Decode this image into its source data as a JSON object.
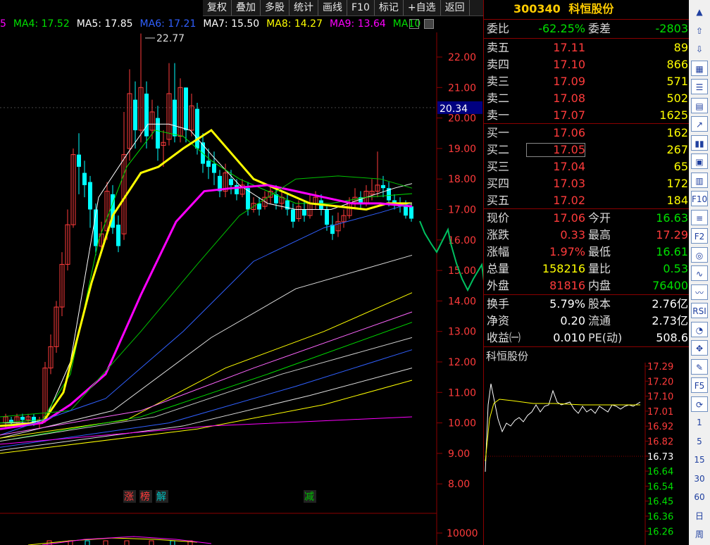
{
  "toolbar": {
    "items": [
      "复权",
      "叠加",
      "多股",
      "统计",
      "画线",
      "F10",
      "标记",
      "+自选",
      "返回"
    ]
  },
  "ma_legend": [
    {
      "label": "5",
      "color": "#ff00ff"
    },
    {
      "label": "MA4: 17.52",
      "color": "#00e000"
    },
    {
      "label": "MA5: 17.85",
      "color": "#ffffff"
    },
    {
      "label": "MA6: 17.21",
      "color": "#3060ff"
    },
    {
      "label": "MA7: 15.50",
      "color": "#ffffff"
    },
    {
      "label": "MA8: 14.27",
      "color": "#ffff00"
    },
    {
      "label": "MA9: 13.64",
      "color": "#ff00ff"
    },
    {
      "label": "MA10",
      "color": "#00e000"
    }
  ],
  "chart": {
    "price_ticks": [
      "22.00",
      "21.00",
      "20.00",
      "19.00",
      "18.00",
      "17.00",
      "16.00",
      "15.00",
      "14.00",
      "13.00",
      "12.00",
      "11.00",
      "10.00",
      "9.00",
      "8.00"
    ],
    "high_label": "22.77",
    "cursor_price": "20.34",
    "volume_tick": "10000",
    "markers": [
      {
        "text": "涨",
        "color": "#ff3b3b"
      },
      {
        "text": "榜",
        "color": "#ff3b3b"
      },
      {
        "text": "解",
        "color": "#00c0c0"
      },
      {
        "text": "减",
        "color": "#00c000"
      }
    ]
  },
  "quote": {
    "code": "300340",
    "name": "科恒股份",
    "weibi_label": "委比",
    "weibi_value": "-62.25%",
    "weicha_label": "委差",
    "weicha_value": "-2803",
    "asks": [
      {
        "label": "卖五",
        "price": "17.11",
        "vol": "89"
      },
      {
        "label": "卖四",
        "price": "17.10",
        "vol": "866"
      },
      {
        "label": "卖三",
        "price": "17.09",
        "vol": "571"
      },
      {
        "label": "卖二",
        "price": "17.08",
        "vol": "502"
      },
      {
        "label": "卖一",
        "price": "17.07",
        "vol": "1625"
      }
    ],
    "bids": [
      {
        "label": "买一",
        "price": "17.06",
        "vol": "162"
      },
      {
        "label": "买二",
        "price": "17.05",
        "vol": "267"
      },
      {
        "label": "买三",
        "price": "17.04",
        "vol": "65"
      },
      {
        "label": "买四",
        "price": "17.03",
        "vol": "172"
      },
      {
        "label": "买五",
        "price": "17.02",
        "vol": "184"
      }
    ],
    "stats": [
      {
        "l1": "现价",
        "v1": "17.06",
        "c1": "red",
        "l2": "今开",
        "v2": "16.63",
        "c2": "green"
      },
      {
        "l1": "涨跌",
        "v1": "0.33",
        "c1": "red",
        "l2": "最高",
        "v2": "17.29",
        "c2": "red"
      },
      {
        "l1": "涨幅",
        "v1": "1.97%",
        "c1": "red",
        "l2": "最低",
        "v2": "16.61",
        "c2": "green"
      },
      {
        "l1": "总量",
        "v1": "158216",
        "c1": "yellow",
        "l2": "量比",
        "v2": "0.53",
        "c2": "green"
      },
      {
        "l1": "外盘",
        "v1": "81816",
        "c1": "red",
        "l2": "内盘",
        "v2": "76400",
        "c2": "green"
      }
    ],
    "stats2": [
      {
        "l1": "换手",
        "v1": "5.79%",
        "l2": "股本",
        "v2": "2.76亿"
      },
      {
        "l1": "净资",
        "v1": "0.20",
        "l2": "流通",
        "v2": "2.73亿"
      },
      {
        "l1": "收益㈠",
        "v1": "0.010",
        "l2": "PE(动)",
        "v2": "508.6"
      }
    ]
  },
  "mini_chart": {
    "title": "科恒股份",
    "ticks": [
      {
        "v": "17.29",
        "c": "#ff3b3b"
      },
      {
        "v": "17.20",
        "c": "#ff3b3b"
      },
      {
        "v": "17.10",
        "c": "#ff3b3b"
      },
      {
        "v": "17.01",
        "c": "#ff3b3b"
      },
      {
        "v": "16.92",
        "c": "#ff3b3b"
      },
      {
        "v": "16.82",
        "c": "#ff3b3b"
      },
      {
        "v": "16.73",
        "c": "#ffffff"
      },
      {
        "v": "16.64",
        "c": "#00e000"
      },
      {
        "v": "16.54",
        "c": "#00e000"
      },
      {
        "v": "16.45",
        "c": "#00e000"
      },
      {
        "v": "16.36",
        "c": "#00e000"
      },
      {
        "v": "16.26",
        "c": "#00e000"
      }
    ]
  },
  "side_bar": {
    "items": [
      {
        "label": "▲",
        "icon": "scroll-up-icon"
      },
      {
        "label": "⇧",
        "icon": "arrow-up-icon"
      },
      {
        "label": "⇩",
        "icon": "arrow-down-icon"
      },
      {
        "label": "▦",
        "icon": "grid-icon"
      },
      {
        "label": "☰",
        "icon": "list-icon"
      },
      {
        "label": "▤",
        "icon": "table-icon"
      },
      {
        "label": "↗",
        "icon": "line-chart-icon"
      },
      {
        "label": "▮▮",
        "icon": "candle-icon"
      },
      {
        "label": "▣",
        "icon": "window-icon"
      },
      {
        "label": "▥",
        "icon": "report-icon"
      },
      {
        "label": "F10",
        "icon": "f10-icon"
      },
      {
        "label": "≡",
        "icon": "menu-icon"
      },
      {
        "label": "F2",
        "icon": "f2-icon"
      },
      {
        "label": "◎",
        "icon": "target-icon"
      },
      {
        "label": "∿",
        "icon": "wave-icon"
      },
      {
        "label": "〰",
        "icon": "macd-icon"
      },
      {
        "label": "RSI",
        "icon": "rsi-icon"
      },
      {
        "label": "◔",
        "icon": "pie-icon"
      },
      {
        "label": "✥",
        "icon": "move-icon"
      },
      {
        "label": "✎",
        "icon": "pencil-icon"
      },
      {
        "label": "F5",
        "icon": "f5-icon"
      },
      {
        "label": "⟳",
        "icon": "refresh-icon"
      },
      {
        "label": "1",
        "icon": "period-1-icon"
      },
      {
        "label": "5",
        "icon": "period-5-icon"
      },
      {
        "label": "15",
        "icon": "period-15-icon"
      },
      {
        "label": "30",
        "icon": "period-30-icon"
      },
      {
        "label": "60",
        "icon": "period-60-icon"
      },
      {
        "label": "日",
        "icon": "period-day-icon"
      },
      {
        "label": "周",
        "icon": "period-week-icon"
      }
    ]
  }
}
